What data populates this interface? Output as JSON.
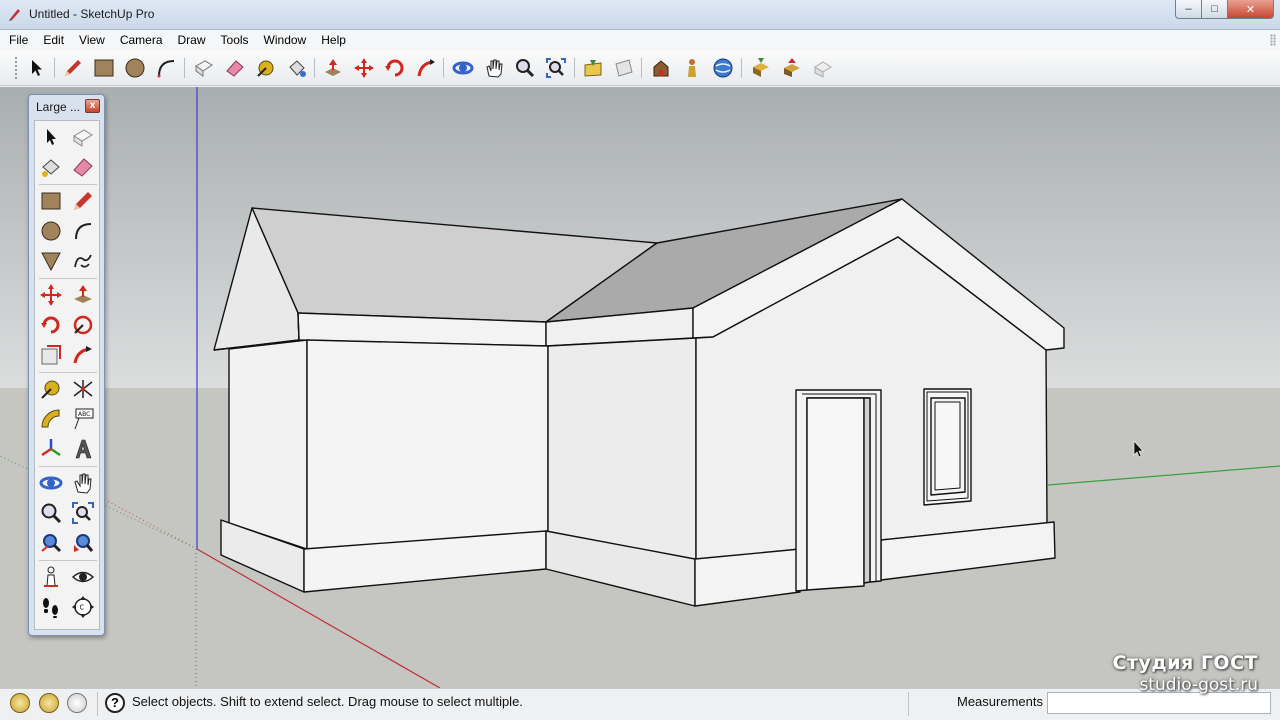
{
  "window": {
    "title": "Untitled - SketchUp Pro"
  },
  "menu": [
    "File",
    "Edit",
    "View",
    "Camera",
    "Draw",
    "Tools",
    "Window",
    "Help"
  ],
  "palette": {
    "title": "Large ...",
    "close_label": "x"
  },
  "status": {
    "hint": "Select objects. Shift to extend select. Drag mouse to select multiple.",
    "measurements_label": "Measurements",
    "measurements_value": ""
  },
  "watermark": {
    "line1": "Студия ГОСТ",
    "line2": "studio-gost.ru"
  },
  "colors": {
    "sky": "#c9cccd",
    "ground": "#c5c5c2",
    "face_light": "#f0f0f0",
    "roof_dark": "#adadad",
    "axis_red": "#c0303a",
    "axis_green": "#37a338",
    "axis_blue": "#3c3cd0"
  }
}
